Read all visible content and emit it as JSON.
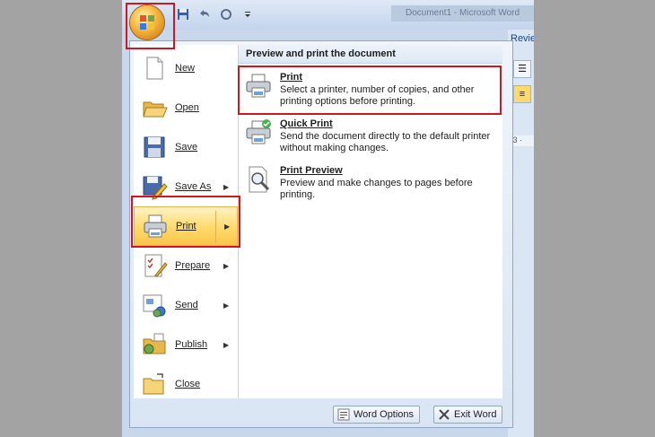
{
  "window": {
    "title_blur": "Document1 - Microsoft Word",
    "ribbon_tab_partial": "Revie",
    "ruler_partial": "· 3 ·"
  },
  "quick_access": {
    "save_icon": "save-icon",
    "undo_icon": "undo-icon",
    "redo_icon": "redo-icon",
    "customize_icon": "customize-qat-icon"
  },
  "office_button": {
    "icon": "office-logo-icon"
  },
  "menu": {
    "left_items": [
      {
        "label": "New",
        "icon": "new-document-icon",
        "has_submenu": false
      },
      {
        "label": "Open",
        "icon": "open-folder-icon",
        "has_submenu": false
      },
      {
        "label": "Save",
        "icon": "save-disk-icon",
        "has_submenu": false
      },
      {
        "label": "Save As",
        "icon": "save-as-icon",
        "has_submenu": true
      },
      {
        "label": "Print",
        "icon": "printer-icon",
        "has_submenu": true
      },
      {
        "label": "Prepare",
        "icon": "prepare-icon",
        "has_submenu": true
      },
      {
        "label": "Send",
        "icon": "send-icon",
        "has_submenu": true
      },
      {
        "label": "Publish",
        "icon": "publish-icon",
        "has_submenu": true
      },
      {
        "label": "Close",
        "icon": "close-folder-icon",
        "has_submenu": false
      }
    ],
    "submenu_header": "Preview and print the document",
    "submenu_items": [
      {
        "title": "Print",
        "desc": "Select a printer, number of copies, and other printing options before printing.",
        "icon": "printer-icon"
      },
      {
        "title": "Quick Print",
        "desc": "Send the document directly to the default printer without making changes.",
        "icon": "quick-print-icon"
      },
      {
        "title": "Print Preview",
        "desc": "Preview and make changes to pages before printing.",
        "icon": "print-preview-icon"
      }
    ],
    "bottom_buttons": {
      "word_options": "Word Options",
      "exit_word": "Exit Word"
    }
  },
  "colors": {
    "highlight_border": "#d0161f",
    "active_item": "#ffd96b",
    "menu_border": "#8ea7c9"
  }
}
